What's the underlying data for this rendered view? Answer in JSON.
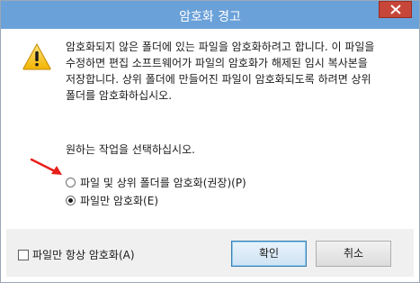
{
  "dialog": {
    "title": "암호화 경고",
    "message": "암호화되지 않은 폴더에 있는 파일을 암호화하려고 합니다. 이 파일을\n수정하면 편집 소프트웨어가 파일의 암호화가 해제된 임시 복사본을\n저장합니다. 상위 폴더에 만들어진 파일이 암호화되도록 하려면 상위\n폴더를 암호화하십시오.",
    "prompt": "원하는 작업을 선택하십시오.",
    "options": [
      {
        "label": "파일 및 상위 폴더를 암호화(권장)(P)",
        "selected": false
      },
      {
        "label": "파일만 암호화(E)",
        "selected": true
      }
    ],
    "always_checkbox": {
      "label": "파일만 항상 암호화(A)",
      "checked": false
    },
    "ok_label": "확인",
    "cancel_label": "취소"
  },
  "colors": {
    "titlebar": "#6aa1d8",
    "close_button": "#c7463a",
    "annotation_arrow": "#e8201a"
  },
  "icons": {
    "warning": "warning-icon",
    "close": "close-icon",
    "annotation": "red-arrow-icon"
  }
}
